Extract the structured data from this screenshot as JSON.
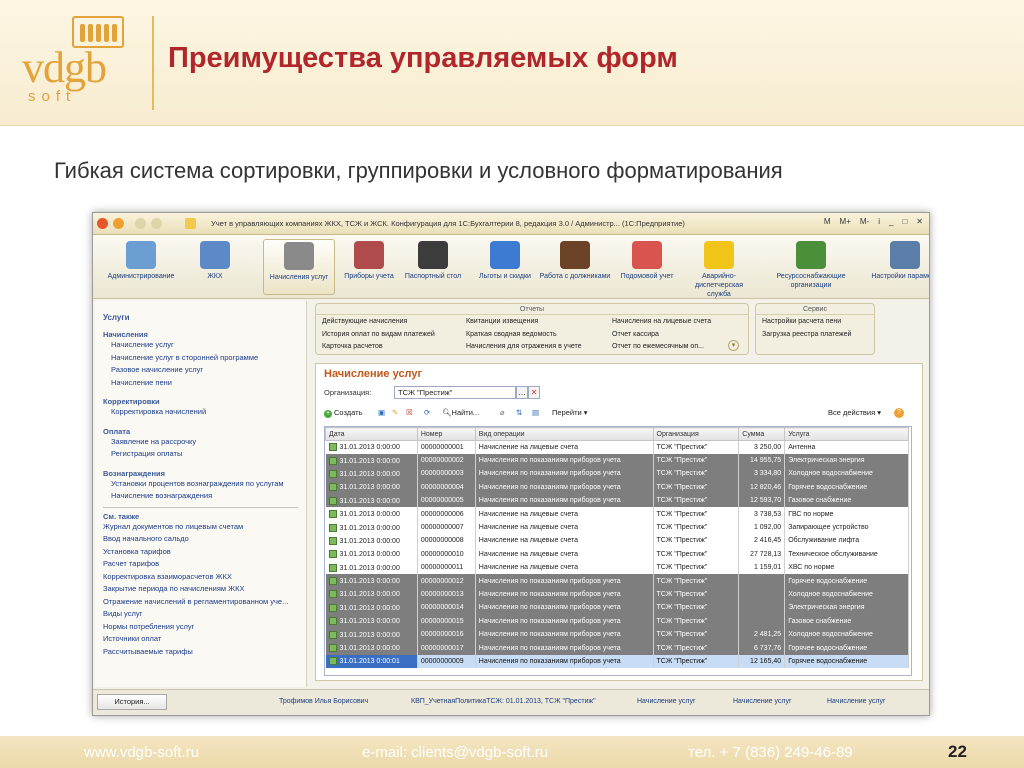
{
  "slide": {
    "title": "Преимущества управляемых форм",
    "subtitle": "Гибкая система сортировки, группировки и условного форматирования",
    "logo_main": "vdgb",
    "logo_sub": "soft",
    "footer_site": "www.vdgb-soft.ru",
    "footer_email": "e-mail: clients@vdgb-soft.ru",
    "footer_phone": "тел. + 7 (836) 249-46-89",
    "page_number": "22",
    "accent_color": "#b0262a",
    "brand_color": "#e2a33a"
  },
  "window": {
    "title": "Учет в управляющих компаниях ЖКХ, ТСЖ и ЖСК. Конфигурация для 1С:Бухгалтерии 8, редакция 3.0 / Администр... (1С:Предприятие)",
    "titlebar_right": [
      "M",
      "M+",
      "M-",
      "i",
      "_",
      "□",
      "✕"
    ]
  },
  "ribbon": [
    {
      "label": "Администрирование",
      "icon": "admin-database-icon",
      "color": "#6b9ed3"
    },
    {
      "label": "ЖКХ",
      "icon": "buildings-icon",
      "color": "#5c8ac7"
    },
    {
      "label": "Начисления услуг",
      "icon": "calculator-icon",
      "color": "#8a8a8a"
    },
    {
      "label": "Приборы учета",
      "icon": "meters-icon",
      "color": "#b04b4b"
    },
    {
      "label": "Паспортный стол",
      "icon": "passport-icon",
      "color": "#3c3c3c"
    },
    {
      "label": "Льготы и скидки",
      "icon": "chart-icon",
      "color": "#3d7ad1"
    },
    {
      "label": "Работа с должниками",
      "icon": "gavel-icon",
      "color": "#6b4226"
    },
    {
      "label": "Подомовой учет",
      "icon": "house-icon",
      "color": "#d9534f"
    },
    {
      "label": "Аварийно-диспетчерская служба",
      "icon": "helmet-icon",
      "color": "#f0c419"
    },
    {
      "label": "Ресурсоснабжающие организации",
      "icon": "people-icon",
      "color": "#4b8f3a"
    },
    {
      "label": "Настройки параметр",
      "icon": "settings-gear-icon",
      "color": "#5a7ea8"
    }
  ],
  "sidebar": {
    "title": "Услуги",
    "sections": [
      {
        "header": "Начисления",
        "items": [
          "Начисление услуг",
          "Начисление услуг в сторонней программе",
          "Разовое начисление услуг",
          "Начисление пени"
        ]
      },
      {
        "header": "Корректировки",
        "items": [
          "Корректировка начислений"
        ]
      },
      {
        "header": "Оплата",
        "items": [
          "Заявление на рассрочку",
          "Регистрация оплаты"
        ]
      },
      {
        "header": "Вознаграждения",
        "items": [
          "Установки процентов вознаграждения по услугам",
          "Начисление вознаграждения"
        ]
      }
    ],
    "see_also_header": "См. также",
    "see_also": [
      "Журнал документов по лицевым счетам",
      "Ввод начального сальдо",
      "Установка тарифов",
      "Расчет тарифов",
      "Корректировка взаиморасчетов ЖКХ",
      "Закрытие периода по начислениям ЖКХ",
      "Отражение начислений в регламентированном уче...",
      "Виды услуг",
      "Нормы потребления услуг",
      "Источники оплат",
      "Рассчитываемые тарифы"
    ]
  },
  "panels": {
    "reports_header": "Отчеты",
    "reports_col1": [
      "Действующие начисления",
      "История оплат по видам платежей",
      "Карточка расчетов"
    ],
    "reports_col2": [
      "Квитанции извещения",
      "Краткая сводная ведомость",
      "Начисления для отражения в учете"
    ],
    "reports_col3": [
      "Начисления на лицевые счета",
      "Отчет кассира",
      "Отчет по ежемесячным оп..."
    ],
    "service_header": "Сервис",
    "service": [
      "Настройки расчета пени",
      "Загрузка реестра платежей"
    ]
  },
  "form": {
    "title": "Начисление услуг",
    "org_label": "Организация:",
    "org_value": "ТСЖ \"Престиж\"",
    "toolbar": {
      "create": "Создать",
      "find": "Найти...",
      "goto": "Перейти",
      "all_actions": "Все действия"
    },
    "columns": [
      "Дата",
      "Номер",
      "Вид операции",
      "Организация",
      "Сумма",
      "Услуга"
    ],
    "rows": [
      {
        "style": "light",
        "date": "31.01.2013 0:00:00",
        "num": "00000000001",
        "op": "Начисление на лицевые счета",
        "org": "ТСЖ \"Престиж\"",
        "sum": "3 250,00",
        "svc": "Антенна"
      },
      {
        "style": "dark",
        "date": "31.01.2013 0:00:00",
        "num": "00000000002",
        "op": "Начисления по показаниям приборов учета",
        "org": "ТСЖ \"Престиж\"",
        "sum": "14 955,75",
        "svc": "Электрическая энергия"
      },
      {
        "style": "dark",
        "date": "31.01.2013 0:00:00",
        "num": "00000000003",
        "op": "Начисления по показаниям приборов учета",
        "org": "ТСЖ \"Престиж\"",
        "sum": "3 334,80",
        "svc": "Холодное водоснабжение"
      },
      {
        "style": "dark",
        "date": "31.01.2013 0:00:00",
        "num": "00000000004",
        "op": "Начисления по показаниям приборов учета",
        "org": "ТСЖ \"Престиж\"",
        "sum": "12 820,46",
        "svc": "Горячее водоснабжение"
      },
      {
        "style": "dark",
        "date": "31.01.2013 0:00:00",
        "num": "00000000005",
        "op": "Начисления по показаниям приборов учета",
        "org": "ТСЖ \"Престиж\"",
        "sum": "12 593,70",
        "svc": "Газовое снабжение"
      },
      {
        "style": "light",
        "date": "31.01.2013 0:00:00",
        "num": "00000000006",
        "op": "Начисление на лицевые счета",
        "org": "ТСЖ \"Престиж\"",
        "sum": "3 738,53",
        "svc": "ГВС по норме"
      },
      {
        "style": "light",
        "date": "31.01.2013 0:00:00",
        "num": "00000000007",
        "op": "Начисление на лицевые счета",
        "org": "ТСЖ \"Престиж\"",
        "sum": "1 092,00",
        "svc": "Запирающее устройство"
      },
      {
        "style": "light",
        "date": "31.01.2013 0:00:00",
        "num": "00000000008",
        "op": "Начисление на лицевые счета",
        "org": "ТСЖ \"Престиж\"",
        "sum": "2 416,45",
        "svc": "Обслуживание лифта"
      },
      {
        "style": "light",
        "date": "31.01.2013 0:00:00",
        "num": "00000000010",
        "op": "Начисление на лицевые счета",
        "org": "ТСЖ \"Престиж\"",
        "sum": "27 728,13",
        "svc": "Техническое обслуживание"
      },
      {
        "style": "light",
        "date": "31.01.2013 0:00:00",
        "num": "00000000011",
        "op": "Начисление на лицевые счета",
        "org": "ТСЖ \"Престиж\"",
        "sum": "1 159,01",
        "svc": "ХВС по норме"
      },
      {
        "style": "dark",
        "date": "31.01.2013 0:00:00",
        "num": "00000000012",
        "op": "Начисления по показаниям приборов учета",
        "org": "ТСЖ \"Престиж\"",
        "sum": "",
        "svc": "Горячее водоснабжение"
      },
      {
        "style": "dark",
        "date": "31.01.2013 0:00:00",
        "num": "00000000013",
        "op": "Начисления по показаниям приборов учета",
        "org": "ТСЖ \"Престиж\"",
        "sum": "",
        "svc": "Холодное водоснабжение"
      },
      {
        "style": "dark",
        "date": "31.01.2013 0:00:00",
        "num": "00000000014",
        "op": "Начисления по показаниям приборов учета",
        "org": "ТСЖ \"Престиж\"",
        "sum": "",
        "svc": "Электрическая энергия"
      },
      {
        "style": "dark",
        "date": "31.01.2013 0:00:00",
        "num": "00000000015",
        "op": "Начисления по показаниям приборов учета",
        "org": "ТСЖ \"Престиж\"",
        "sum": "",
        "svc": "Газовое снабжение"
      },
      {
        "style": "dark",
        "date": "31.01.2013 0:00:00",
        "num": "00000000016",
        "op": "Начисления по показаниям приборов учета",
        "org": "ТСЖ \"Престиж\"",
        "sum": "2 481,25",
        "svc": "Холодное водоснабжение"
      },
      {
        "style": "dark",
        "date": "31.01.2013 0:00:00",
        "num": "00000000017",
        "op": "Начисления по показаниям приборов учета",
        "org": "ТСЖ \"Престиж\"",
        "sum": "6 737,76",
        "svc": "Горячее водоснабжение"
      },
      {
        "style": "sel",
        "date": "31.01.2013 0:00:01",
        "num": "00000000009",
        "op": "Начисления по показаниям приборов учета",
        "org": "ТСЖ \"Престиж\"",
        "sum": "12 165,40",
        "svc": "Горячее водоснабжение"
      }
    ]
  },
  "statusbar": {
    "history": "История...",
    "items": [
      "Трофимов Илья Борисович",
      "КВП_УчетнаяПолитикаТСЖ: 01.01.2013, ТСЖ \"Престиж\"",
      "Начисление услуг",
      "Начисление услуг",
      "Начисление услуг"
    ]
  }
}
